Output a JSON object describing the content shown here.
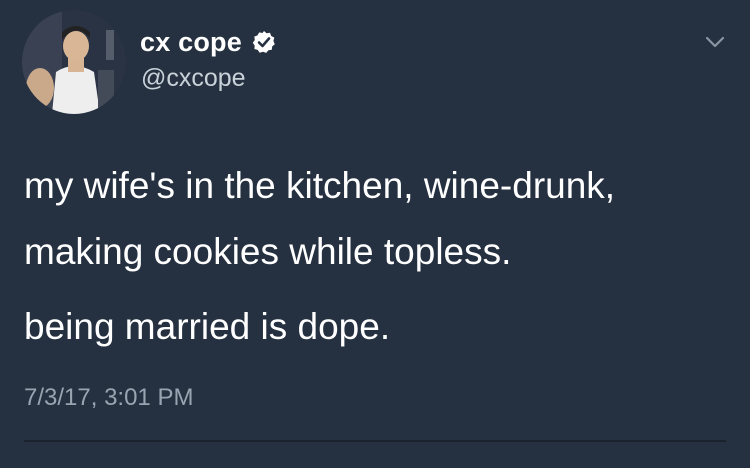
{
  "user": {
    "display_name": "cx cope",
    "handle": "@cxcope",
    "verified": true
  },
  "tweet": {
    "lines": [
      "my wife's in the kitchen, wine-drunk,",
      "making cookies while topless.",
      "being married is dope."
    ],
    "timestamp": "7/3/17, 3:01 PM"
  },
  "icons": {
    "verified": "verified-badge-icon",
    "menu": "chevron-down-icon"
  },
  "colors": {
    "background": "#253141",
    "text": "#ffffff",
    "secondary_text": "#9aa4b1"
  }
}
